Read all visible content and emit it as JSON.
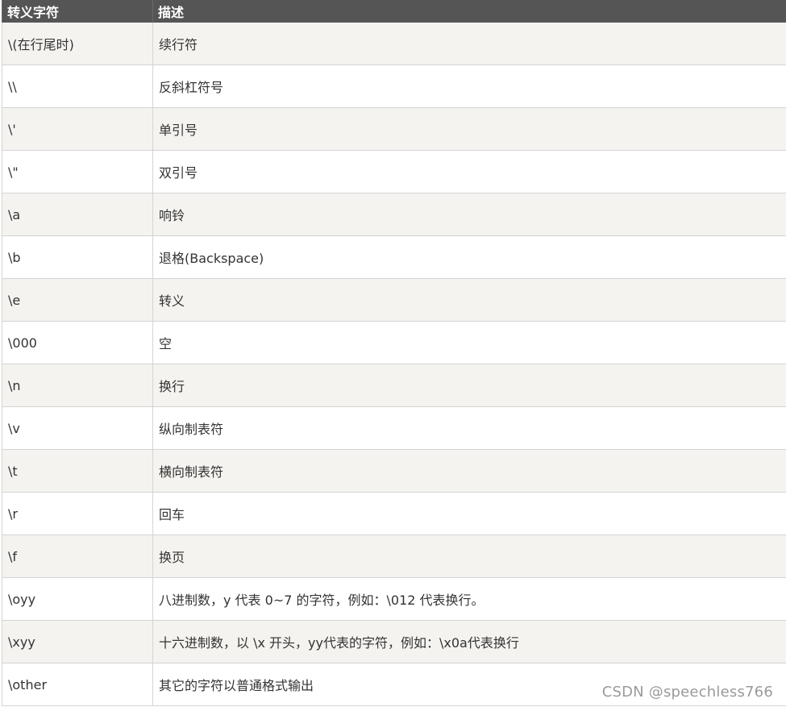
{
  "table": {
    "headers": {
      "escape": "转义字符",
      "description": "描述"
    },
    "rows": [
      {
        "escape": "\\(在行尾时)",
        "description": "续行符"
      },
      {
        "escape": "\\\\",
        "description": "反斜杠符号"
      },
      {
        "escape": "\\'",
        "description": "单引号"
      },
      {
        "escape": "\\\"",
        "description": "双引号"
      },
      {
        "escape": "\\a",
        "description": "响铃"
      },
      {
        "escape": "\\b",
        "description": "退格(Backspace)"
      },
      {
        "escape": "\\e",
        "description": "转义"
      },
      {
        "escape": "\\000",
        "description": "空"
      },
      {
        "escape": "\\n",
        "description": "换行"
      },
      {
        "escape": "\\v",
        "description": "纵向制表符"
      },
      {
        "escape": "\\t",
        "description": "横向制表符"
      },
      {
        "escape": "\\r",
        "description": "回车"
      },
      {
        "escape": "\\f",
        "description": "换页"
      },
      {
        "escape": "\\oyy",
        "description": "八进制数，y 代表 0~7 的字符，例如：\\012 代表换行。"
      },
      {
        "escape": "\\xyy",
        "description": "十六进制数，以 \\x 开头，yy代表的字符，例如：\\x0a代表换行"
      },
      {
        "escape": "\\other",
        "description": "其它的字符以普通格式输出"
      }
    ]
  },
  "watermark": "CSDN @speechless766",
  "colors": {
    "header_bg": "#555555",
    "header_text": "#ffffff",
    "row_odd_bg": "#f4f3ef",
    "row_even_bg": "#ffffff",
    "border": "#d4d4d4",
    "text": "#333333"
  }
}
